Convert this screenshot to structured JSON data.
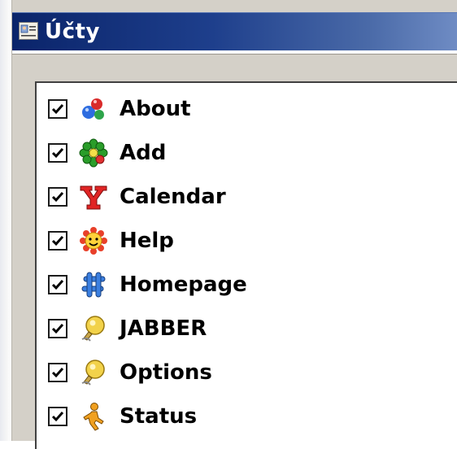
{
  "window": {
    "title": "Účty",
    "title_icon": "address-card-icon",
    "titlebar_colors": [
      "#0a246a",
      "#6f8cc4"
    ]
  },
  "items": [
    {
      "label": "About",
      "checked": true,
      "icon": "molecule-icon"
    },
    {
      "label": "Add",
      "checked": true,
      "icon": "icq-flower-icon"
    },
    {
      "label": "Calendar",
      "checked": true,
      "icon": "yahoo-y-icon"
    },
    {
      "label": "Help",
      "checked": true,
      "icon": "smiley-sun-icon"
    },
    {
      "label": "Homepage",
      "checked": true,
      "icon": "hash-puzzle-icon"
    },
    {
      "label": "JABBER",
      "checked": true,
      "icon": "jabber-bulb-icon"
    },
    {
      "label": "Options",
      "checked": true,
      "icon": "jabber-bulb-icon"
    },
    {
      "label": "Status",
      "checked": true,
      "icon": "aim-runner-icon"
    }
  ]
}
